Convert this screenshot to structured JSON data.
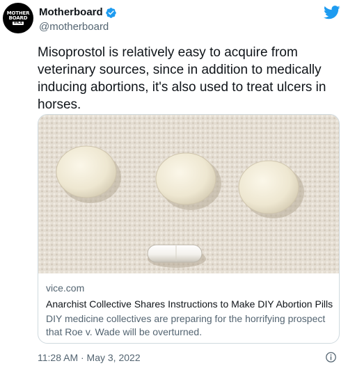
{
  "author": {
    "display_name": "Motherboard",
    "handle": "@motherboard",
    "avatar_text": [
      "MOTHER",
      "BOARD",
      "VICE"
    ],
    "verified": true
  },
  "tweet": {
    "text": "Misoprostol is relatively easy to acquire from veterinary sources, since in addition to medically inducing abortions, it's also used to treat ulcers in horses.",
    "timestamp": "11:28 AM · May 3, 2022"
  },
  "card": {
    "domain": "vice.com",
    "title": "Anarchist Collective Shares Instructions to Make DIY Abortion Pills",
    "description": "DIY medicine collectives are preparing for the horrifying prospect that Roe v. Wade will be overturned.",
    "image": "photo of three round white tablets and a white capsule on a white towel"
  },
  "icons": {
    "brand": "twitter-bird-icon",
    "verified": "verified-badge-icon",
    "info": "info-icon"
  },
  "colors": {
    "twitter_blue": "#1d9bf0",
    "text_primary": "#0f1419",
    "text_secondary": "#536471",
    "border": "#cfd9de"
  }
}
